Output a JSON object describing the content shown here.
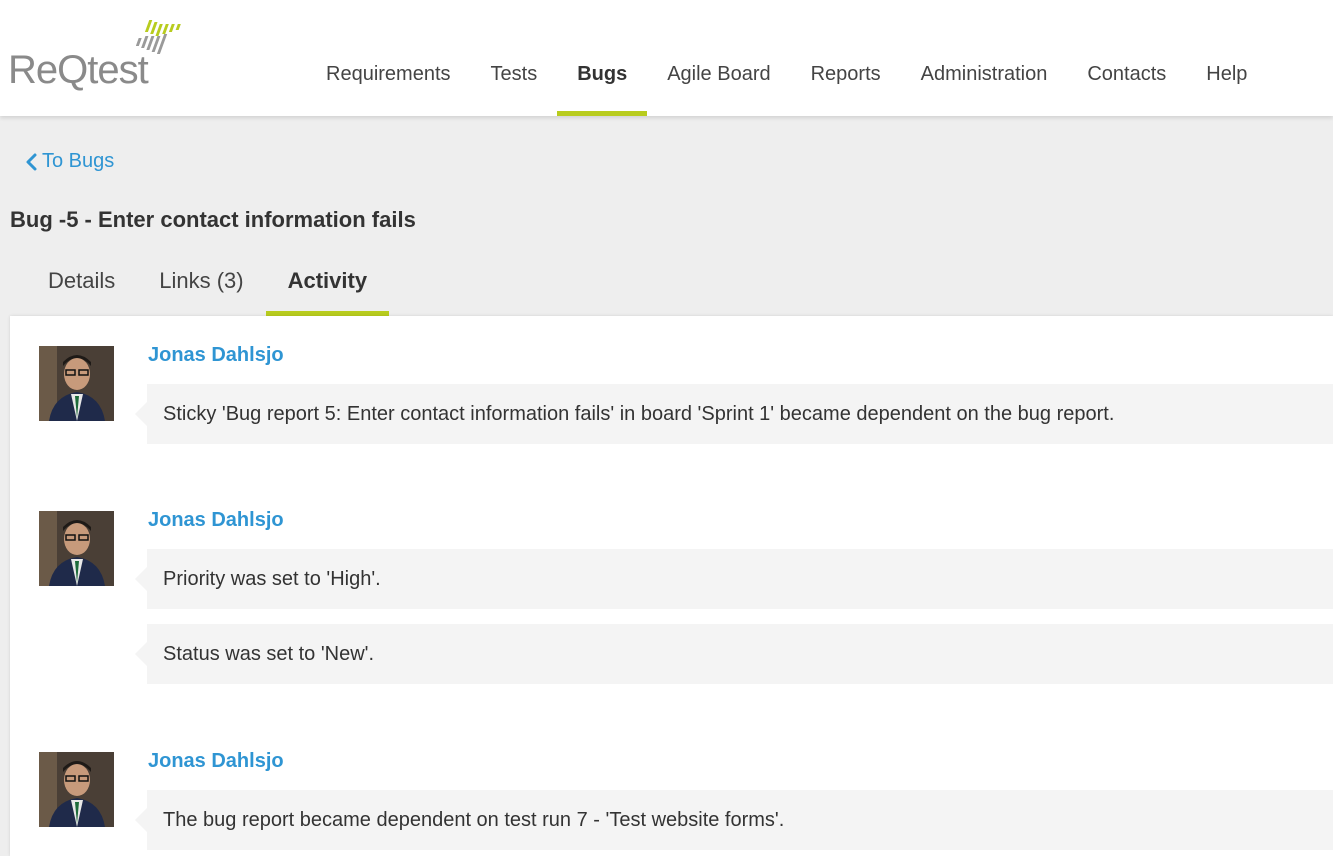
{
  "logo": {
    "text_re": "Re",
    "text_q": "Q",
    "text_test": "test",
    "accent": "#b8cc1e"
  },
  "nav": {
    "items": [
      {
        "label": "Requirements"
      },
      {
        "label": "Tests"
      },
      {
        "label": "Bugs",
        "active": true
      },
      {
        "label": "Agile Board"
      },
      {
        "label": "Reports"
      },
      {
        "label": "Administration"
      },
      {
        "label": "Contacts"
      },
      {
        "label": "Help"
      }
    ]
  },
  "back_link": {
    "icon": "chevron-left-icon",
    "label": "To Bugs"
  },
  "page_title": "Bug -5 - Enter contact information fails",
  "tabs": [
    {
      "label": "Details"
    },
    {
      "label": "Links (3)"
    },
    {
      "label": "Activity",
      "active": true
    }
  ],
  "activity": [
    {
      "author": "Jonas Dahlsjo",
      "messages": [
        "Sticky 'Bug report 5: Enter contact information fails' in board 'Sprint 1' became dependent on the bug report."
      ]
    },
    {
      "author": "Jonas Dahlsjo",
      "messages": [
        "Priority was set to 'High'.",
        "Status was set to 'New'."
      ]
    },
    {
      "author": "Jonas Dahlsjo",
      "messages": [
        "The bug report became dependent on test run 7 - 'Test website forms'."
      ]
    }
  ],
  "colors": {
    "accent": "#b8cc1e",
    "link": "#2f95d3",
    "background": "#eeeeee"
  }
}
